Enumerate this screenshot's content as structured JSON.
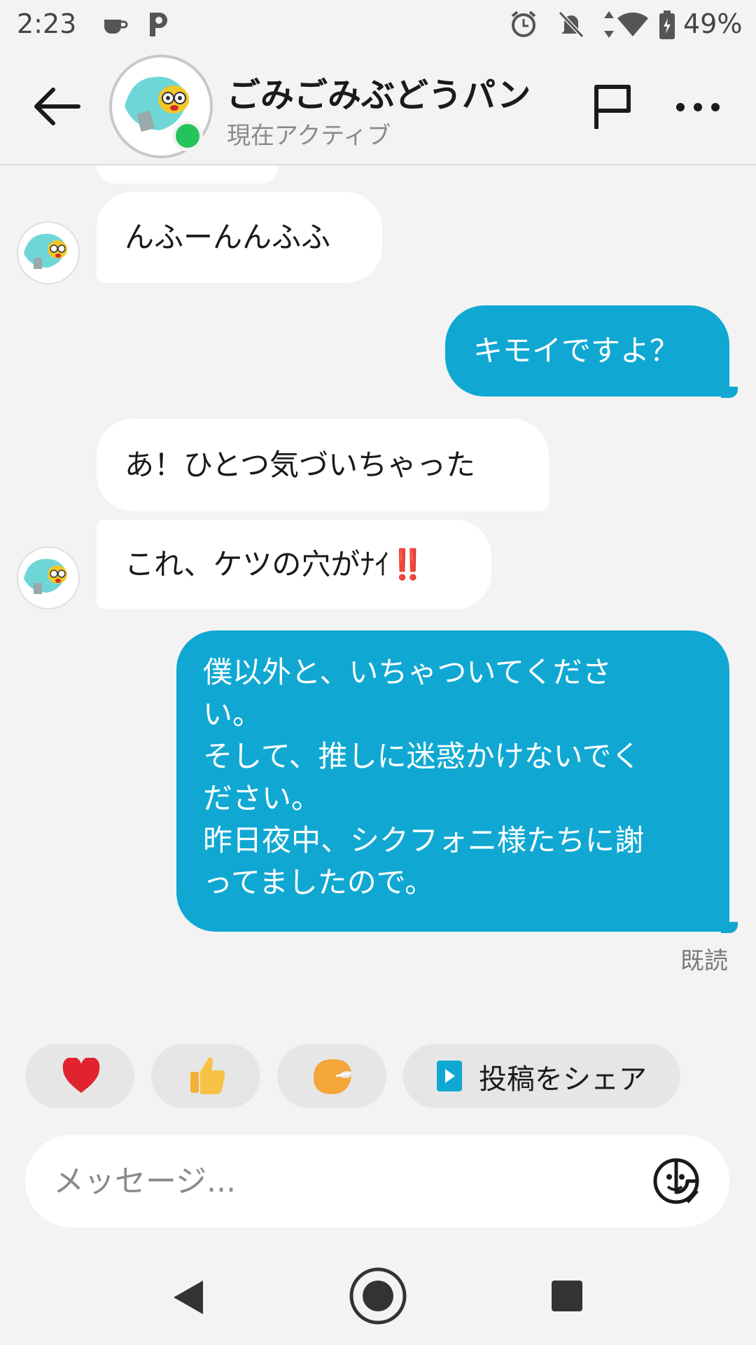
{
  "status_bar": {
    "time": "2:23",
    "battery": "49%",
    "icons": [
      "coffee-icon",
      "p-app-icon",
      "alarm-icon",
      "bell-off-icon",
      "data-arrows-icon",
      "wifi-icon",
      "battery-icon"
    ]
  },
  "header": {
    "name": "ごみごみぶどうパン",
    "status": "現在アクティブ"
  },
  "messages": [
    {
      "from": "them",
      "text": "んふーんんふふ"
    },
    {
      "from": "me",
      "text": "キモイですよ？"
    },
    {
      "from": "them",
      "text": "あ！ひとつ気づいちゃった"
    },
    {
      "from": "them",
      "text": "これ、ケツの穴がﾅｲ‼️"
    },
    {
      "from": "me",
      "lines": [
        "僕以外と、いちゃついてくださ",
        "い。",
        "そして、推しに迷惑かけないでく",
        "ださい。",
        "昨日夜中、シクフォニ様たちに謝",
        "ってましたので。"
      ]
    }
  ],
  "read_receipt": "既読",
  "reactions": [
    {
      "icon": "heart-icon"
    },
    {
      "icon": "thumbs-up-icon"
    },
    {
      "icon": "fortune-cookie-icon"
    },
    {
      "icon": "share-post-icon",
      "label": "投稿をシェア"
    }
  ],
  "composer": {
    "placeholder": "メッセージ..."
  },
  "colors": {
    "outgoing": "#10a8d3",
    "incoming": "#ffffff",
    "online": "#25c45a",
    "background": "#f3f3f3"
  }
}
